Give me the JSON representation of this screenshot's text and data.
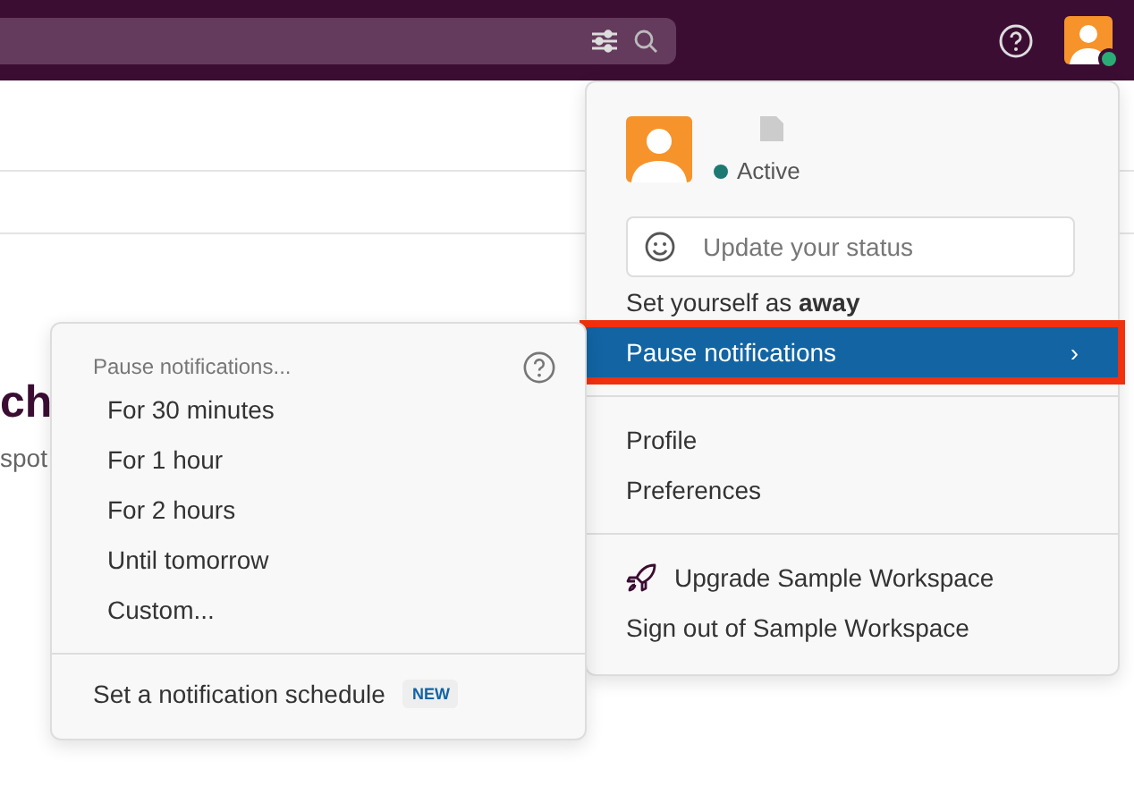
{
  "top_bar": {
    "status_online": true
  },
  "page": {
    "heading": "ch",
    "subtitle": "spot"
  },
  "user_menu": {
    "status": "Active",
    "status_field": {
      "placeholder": "Update your status"
    },
    "sections": [
      [
        {
          "label": "Set yourself as **away**",
          "selected": false,
          "highlighted": false
        },
        {
          "label": "Pause notifications",
          "selected": true,
          "highlighted": true,
          "chevron": "›"
        }
      ],
      [
        {
          "label": "Profile",
          "selected": false,
          "highlighted": false
        },
        {
          "label": "Preferences",
          "selected": false,
          "highlighted": false
        }
      ],
      [
        {
          "label": "Upgrade Sample Workspace",
          "selected": false,
          "highlighted": false,
          "kind": "upgrade"
        },
        {
          "label": "Sign out of Sample Workspace",
          "selected": false,
          "highlighted": false
        }
      ]
    ]
  },
  "submenu": {
    "header": "Pause notifications...",
    "items": [
      {
        "label": "For 30 minutes"
      },
      {
        "label": "For 1 hour"
      },
      {
        "label": "For 2 hours"
      },
      {
        "label": "Until tomorrow"
      },
      {
        "label": "Custom..."
      }
    ],
    "footer": {
      "label": "Set a notification schedule",
      "badge": "NEW"
    }
  }
}
